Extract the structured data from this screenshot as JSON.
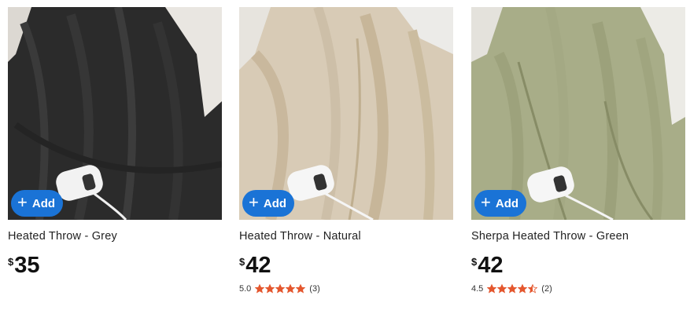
{
  "colors": {
    "add_button": "#1a73d6",
    "star": "#e4572e"
  },
  "add_button": {
    "label": "Add",
    "icon": "plus-icon"
  },
  "products": [
    {
      "title": "Heated Throw - Grey",
      "currency": "$",
      "price": "35",
      "image": "grey-heated-throw-photo",
      "rating": null
    },
    {
      "title": "Heated Throw - Natural",
      "currency": "$",
      "price": "42",
      "image": "natural-heated-throw-photo",
      "rating": {
        "score": "5.0",
        "value": 5.0,
        "count": "(3)"
      }
    },
    {
      "title": "Sherpa Heated Throw - Green",
      "currency": "$",
      "price": "42",
      "image": "green-sherpa-heated-throw-photo",
      "rating": {
        "score": "4.5",
        "value": 4.5,
        "count": "(2)"
      }
    }
  ]
}
